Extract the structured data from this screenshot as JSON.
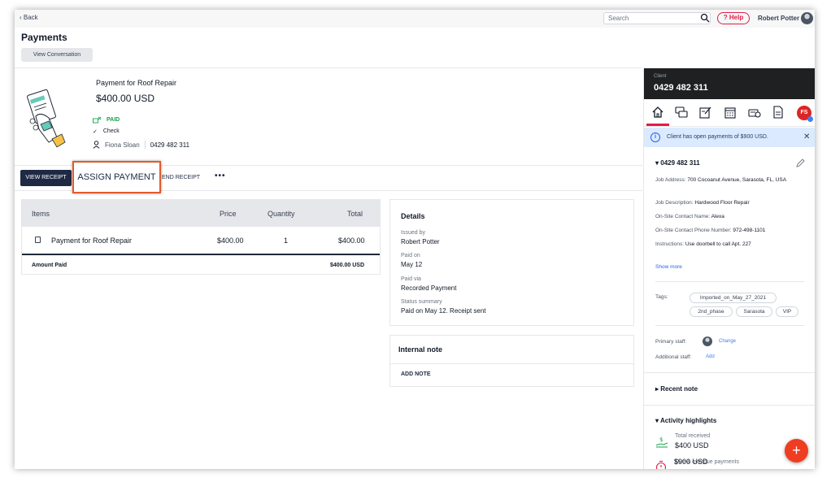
{
  "topbar": {
    "back_label": "Back",
    "search_placeholder": "Search",
    "help_label": "Help",
    "user_name": "Robert Potter"
  },
  "header": {
    "title": "Payments",
    "view_conversation_label": "View Conversation"
  },
  "payment": {
    "title": "Payment for Roof Repair",
    "amount": "$400.00 USD",
    "status": "PAID",
    "method": "Check",
    "client_name": "Fiona Sloan",
    "client_phone": "0429 482 311"
  },
  "actions": {
    "view_receipt": "VIEW RECEIPT",
    "assign_payment": "ASSIGN PAYMENT",
    "send_receipt": "END RECEIPT",
    "more": "•••"
  },
  "items_table": {
    "headers": [
      "Items",
      "Price",
      "Quantity",
      "Total"
    ],
    "rows": [
      {
        "item": "Payment for Roof Repair",
        "price": "$400.00",
        "quantity": "1",
        "total": "$400.00"
      }
    ],
    "amount_paid_label": "Amount Paid",
    "amount_paid_value": "$400.00 USD"
  },
  "details": {
    "title": "Details",
    "issued_by_label": "Issued by",
    "issued_by": "Robert Potter",
    "paid_on_label": "Paid on",
    "paid_on": "May 12",
    "paid_via_label": "Paid via",
    "paid_via": "Recorded Payment",
    "status_label": "Status summary",
    "status_summary": "Paid on May 12. Receipt sent"
  },
  "internal_note": {
    "title": "Internal note",
    "add_note": "ADD NOTE"
  },
  "right_panel": {
    "client_label": "Client",
    "client_phone": "0429 482 311",
    "avatar_initials": "FS",
    "info_message": "Client has open payments of $900 USD.",
    "job_title": "0429 482 311",
    "job_address_label": "Job Address:",
    "job_address": "700 Cocoanut Avenue, Sarasota, FL, USA",
    "job_description_label": "Job Description:",
    "job_description": "Hardwood Floor Repair",
    "contact_name_label": "On-Site Contact Name:",
    "contact_name": "Alexa",
    "contact_phone_label": "On-Site Contact Phone Number:",
    "contact_phone": "972-498-1101",
    "instructions_label": "Instructions:",
    "instructions": "Use doorbell to call Apt. 227",
    "show_more": "Show more",
    "tags_label": "Tags:",
    "tags": [
      "Imported_on_May_27_2021",
      "2nd_phase",
      "Sarasota",
      "VIP"
    ],
    "primary_staff_label": "Primary staff:",
    "change_label": "Change",
    "additional_staff_label": "Additional staff:",
    "add_label": "Add",
    "recent_note_title": "Recent note",
    "activity_title": "Activity highlights",
    "total_received_label": "Total received",
    "total_received": "$400 USD",
    "due_label": "Due & overdue payments",
    "due_value": "$900 USD"
  },
  "fab_label": "+",
  "colors": {
    "accent_red": "#e11d48",
    "navy": "#1e2a44",
    "paid_green": "#16a34a",
    "highlight_border": "#e35a2b",
    "fab": "#ef3d22"
  }
}
